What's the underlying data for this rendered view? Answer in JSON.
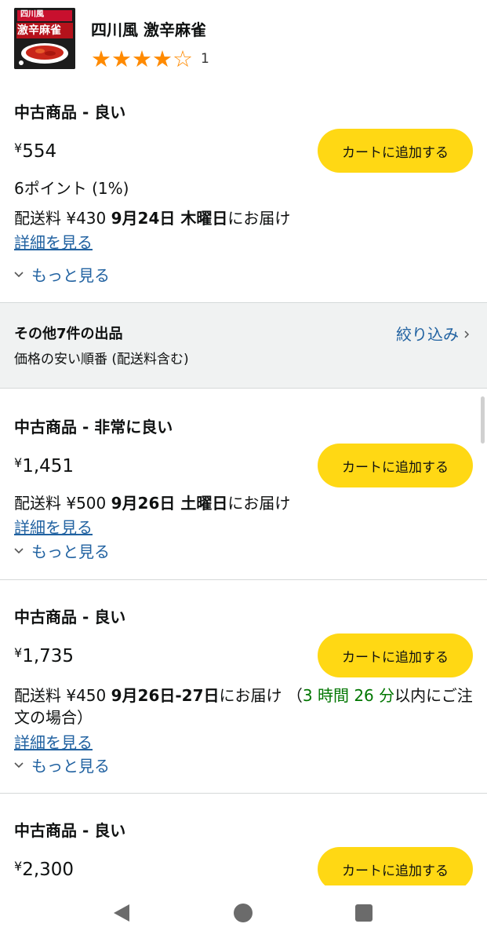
{
  "product": {
    "title": "四川風 激辛麻雀",
    "thumbnail_text": [
      "四川風",
      "激辛麻雀"
    ],
    "rating_stars": 4,
    "rating_max": 5,
    "rating_count": "1"
  },
  "colors": {
    "cart_button": "#ffd814",
    "link": "#2162a1",
    "star": "#ff8a00",
    "countdown": "#007600"
  },
  "featured_offer": {
    "condition": "中古商品 - 良い",
    "currency": "¥",
    "price": "554",
    "cart_label": "カートに追加する",
    "points": "6ポイント (1%)",
    "delivery_prefix": "配送料 ¥430 ",
    "delivery_date": "9月24日 木曜日",
    "delivery_suffix": "にお届け",
    "details_link": "詳細を見る",
    "more_label": "もっと見る"
  },
  "other_offers": {
    "title": "その他7件の出品",
    "sort_label": "価格の安い順番 (配送料含む)",
    "filter_label": "絞り込み"
  },
  "offers": [
    {
      "condition": "中古商品 - 非常に良い",
      "currency": "¥",
      "price": "1,451",
      "cart_label": "カートに追加する",
      "delivery_prefix": "配送料 ¥500 ",
      "delivery_date": "9月26日 土曜日",
      "delivery_suffix": "にお届け",
      "details_link": "詳細を見る",
      "more_label": "もっと見る"
    },
    {
      "condition": "中古商品 - 良い",
      "currency": "¥",
      "price": "1,735",
      "cart_label": "カートに追加する",
      "delivery_prefix": "配送料 ¥450 ",
      "delivery_date": "9月26日-27日",
      "delivery_suffix": "にお届け ",
      "delivery_paren_open": "（",
      "countdown": "3 時間 26 分",
      "delivery_tail": "以内にご注文の場合）",
      "details_link": "詳細を見る",
      "more_label": "もっと見る"
    },
    {
      "condition": "中古商品 - 良い",
      "currency": "¥",
      "price": "2,300",
      "cart_label": "カートに追加する"
    }
  ]
}
